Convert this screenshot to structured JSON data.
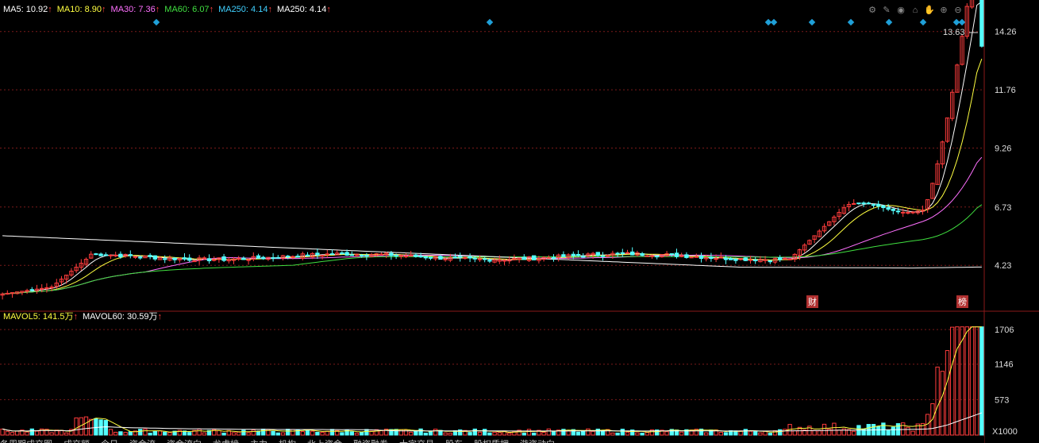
{
  "legend_price": [
    {
      "label": "MA5: 10.92",
      "color": "#ffffff"
    },
    {
      "label": "MA10: 8.90",
      "color": "#ffff40"
    },
    {
      "label": "MA30: 7.36",
      "color": "#ff70ff"
    },
    {
      "label": "MA60: 6.07",
      "color": "#40e040"
    },
    {
      "label": "MA250: 4.14",
      "color": "#40d0ff"
    },
    {
      "label": "MA250: 4.14",
      "color": "#ffffff"
    }
  ],
  "legend_volume": [
    {
      "label": "MAVOL5: 141.5万",
      "color": "#ffff40"
    },
    {
      "label": "MAVOL60: 30.59万",
      "color": "#ffffff"
    }
  ],
  "arrow_glyph": "↑",
  "toolbar_icons": [
    "gear-icon",
    "pencil-icon",
    "eye-icon",
    "basket-icon",
    "hand-icon",
    "zoom-in-icon",
    "zoom-out-icon"
  ],
  "toolbar_glyphs": [
    "⚙",
    "✎",
    "◉",
    "⌂",
    "✋",
    "⊕",
    "⊖"
  ],
  "max_price_label": "13.63",
  "tags": {
    "finance": "财",
    "list": "榜"
  },
  "colors": {
    "up": "#ff3c3c",
    "down": "#54ffff",
    "grid": "#7a1a1a",
    "axis_text": "#dddddd",
    "marker": "#1fa0d8"
  },
  "chart_data": [
    {
      "type": "candlestick",
      "ylim": [
        2.5,
        15.0
      ],
      "yticks": [
        "14.26",
        "11.76",
        "9.26",
        "6.73",
        "4.23"
      ],
      "ytick_values": [
        14.26,
        11.76,
        9.26,
        6.73,
        4.23
      ],
      "last_close": 13.63,
      "ma_last": {
        "MA5": 10.92,
        "MA10": 8.9,
        "MA30": 7.36,
        "MA60": 6.07,
        "MA250": 4.14
      }
    },
    {
      "type": "bar",
      "yticks": [
        "1706",
        "1146",
        "573",
        "X1000"
      ],
      "ytick_values": [
        1706,
        1146,
        573
      ],
      "unit": "X1000",
      "ylim": [
        0,
        1900
      ]
    }
  ],
  "bottom_tabs": [
    "各周期成交图",
    "成交额",
    "今日",
    "资金流",
    "资金流向",
    "龙虎榜",
    "主力",
    "机构",
    "北上资金",
    "融资融券",
    "大宗交易",
    "股东",
    "股权质押",
    "游资动向"
  ]
}
